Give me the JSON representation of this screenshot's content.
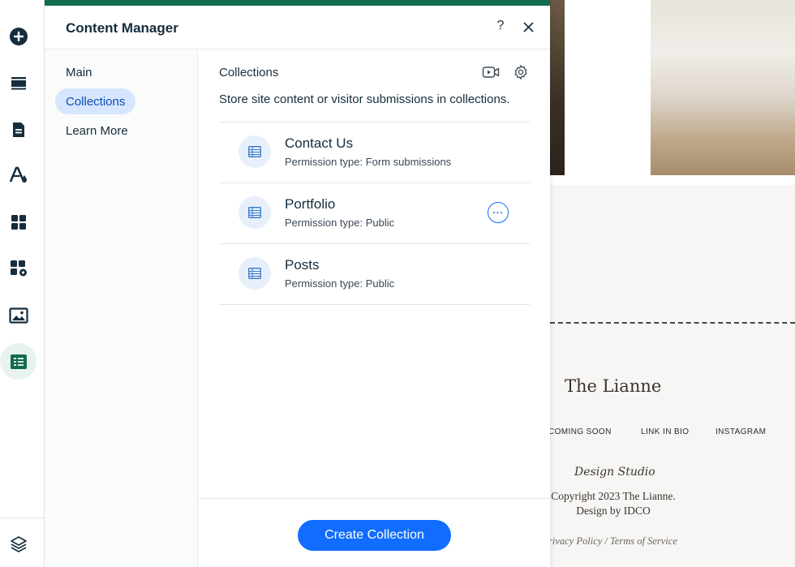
{
  "rail": {
    "items": [
      {
        "name": "add-icon"
      },
      {
        "name": "sections-icon"
      },
      {
        "name": "pages-icon"
      },
      {
        "name": "design-icon"
      },
      {
        "name": "apps-icon"
      },
      {
        "name": "app-market-icon"
      },
      {
        "name": "media-icon"
      },
      {
        "name": "cms-icon",
        "active": true
      }
    ],
    "bottom": {
      "name": "layers-icon"
    }
  },
  "panel": {
    "title": "Content Manager",
    "help_label": "?",
    "accent_color": "#116d4e",
    "nav": [
      {
        "label": "Main"
      },
      {
        "label": "Collections",
        "active": true
      },
      {
        "label": "Learn More"
      }
    ],
    "section_title": "Collections",
    "section_description": "Store site content or visitor submissions in collections.",
    "collections": [
      {
        "name": "Contact Us",
        "permission": "Permission type: Form submissions"
      },
      {
        "name": "Portfolio",
        "permission": "Permission type: Public",
        "show_more": true
      },
      {
        "name": "Posts",
        "permission": "Permission type: Public"
      }
    ],
    "more_label": "···",
    "create_button": "Create Collection",
    "primary_color": "#116dff"
  },
  "site_preview": {
    "brand": "The Lianne",
    "links": [
      "COMING SOON",
      "LINK IN BIO",
      "INSTAGRAM"
    ],
    "studio": "Design Studio",
    "copyright_line1": "Copyright 2023 The Lianne.",
    "copyright_line2": "Design by IDCO",
    "policy": "rivacy Policy / Terms of Service"
  }
}
